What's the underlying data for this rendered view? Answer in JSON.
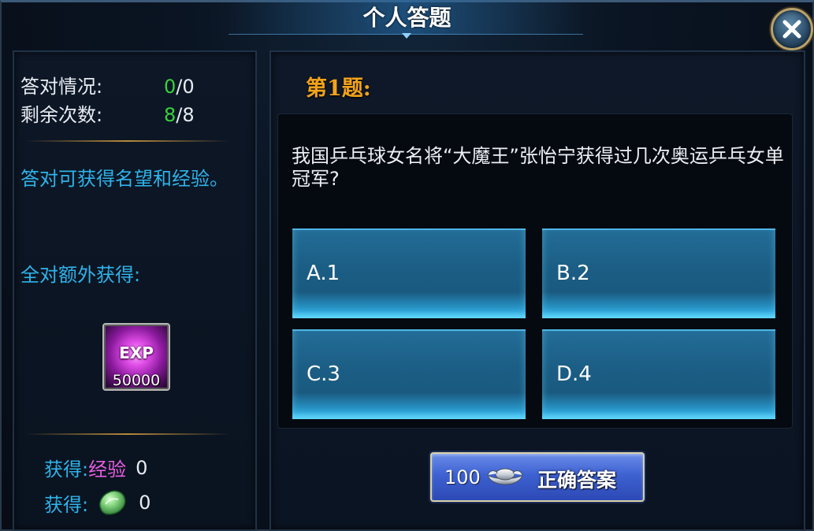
{
  "window": {
    "title": "个人答题"
  },
  "stats": {
    "correct_label": "答对情况:",
    "correct_current": "0",
    "correct_total": "/0",
    "remaining_label": "剩余次数:",
    "remaining_current": "8",
    "remaining_total": "/8"
  },
  "rewards": {
    "description": "答对可获得名望和经验。",
    "bonus_label": "全对额外获得:",
    "exp_icon_text": "EXP",
    "exp_amount": "50000",
    "gain_prefix": "获得:",
    "exp_item_name": "经验",
    "exp_gained": "0",
    "jade_gained": "0"
  },
  "question": {
    "number_label": "第1题:",
    "text": "我国乒乓球女名将“大魔王”张怡宁获得过几次奥运乒乓女单冠军?",
    "options": [
      {
        "label": "A.1"
      },
      {
        "label": "B.2"
      },
      {
        "label": "C.3"
      },
      {
        "label": "D.4"
      }
    ]
  },
  "answer_button": {
    "cost": "100",
    "currency_icon": "silver-ingot-icon",
    "label": "正确答案"
  },
  "colors": {
    "accent_green": "#38d23b",
    "info_blue": "#2fb3ea",
    "question_orange": "#f2a31c",
    "item_purple": "#e85ee0"
  }
}
